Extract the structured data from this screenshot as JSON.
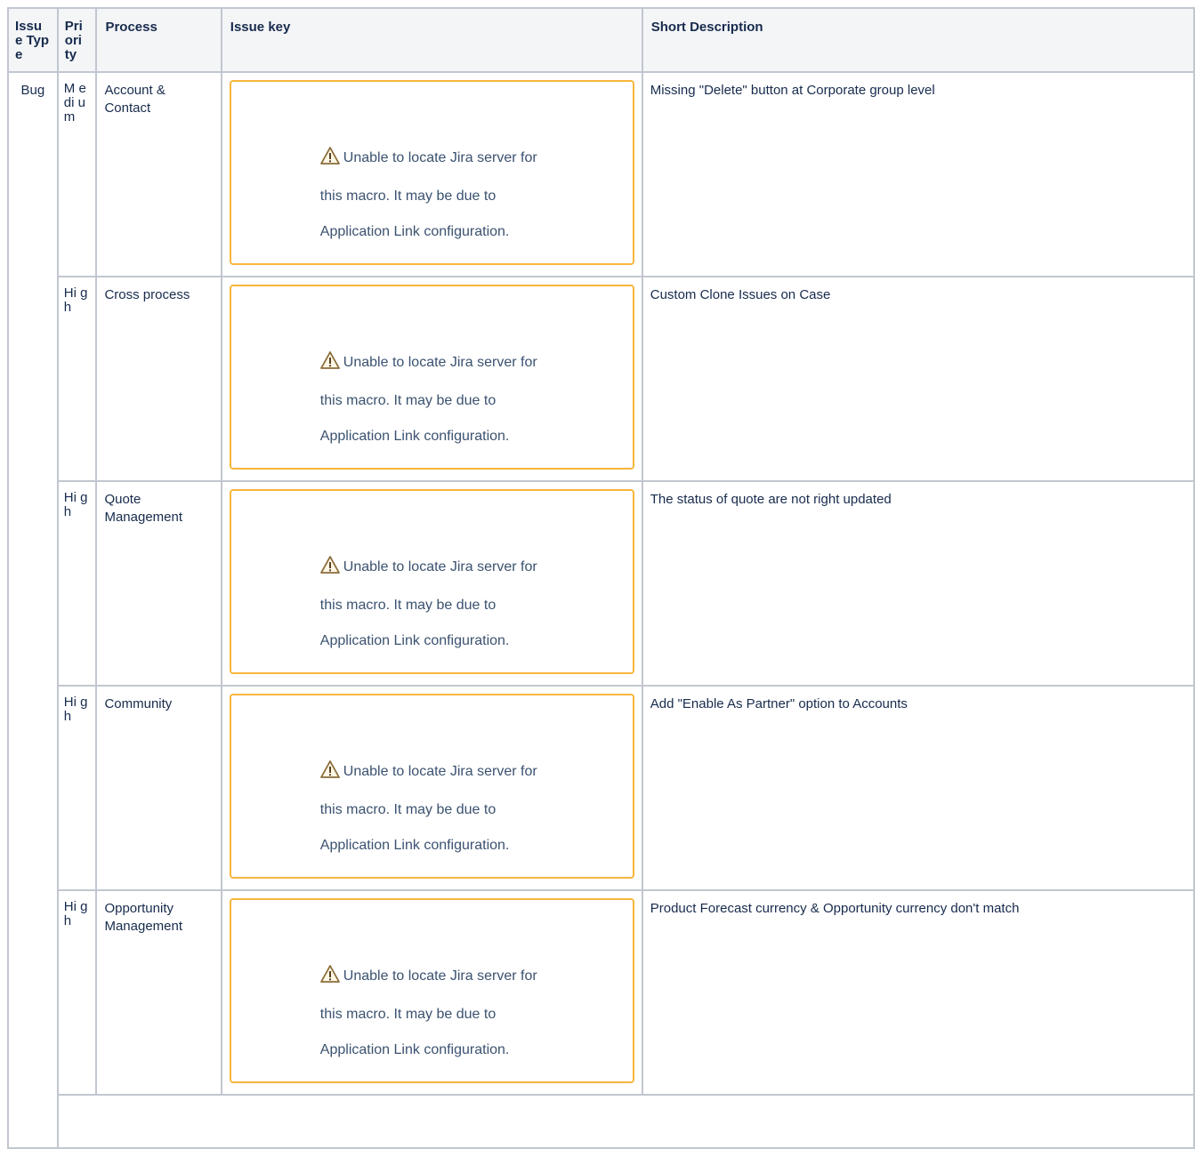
{
  "headers": {
    "issue_type": "Issu e Type",
    "priority": "Pri ori ty",
    "process": "Process",
    "issue_key": "Issue key",
    "short_description": "Short Description"
  },
  "issue_type_value": "Bug",
  "warning_text_line1": "Unable to locate Jira server for",
  "warning_text_line2": "this macro. It may be due to",
  "warning_text_line3": "Application Link configuration.",
  "rows": [
    {
      "priority": "M edi um",
      "process": "Account & Contact",
      "description": "Missing \"Delete\" button at Corporate group level"
    },
    {
      "priority": "Hi gh",
      "process": "Cross process",
      "description": "Custom Clone Issues on Case"
    },
    {
      "priority": "Hi gh",
      "process": "Quote Management",
      "description": "The status of quote are not right updated"
    },
    {
      "priority": "Hi gh",
      "process": "Community",
      "description": "Add \"Enable As Partner\" option to Accounts"
    },
    {
      "priority": "Hi gh",
      "process": "Opportunity Management",
      "description": "Product Forecast currency & Opportunity currency don't match"
    }
  ],
  "icons": {
    "warning": "warning-triangle-icon"
  },
  "colors": {
    "border": "#c1c7d0",
    "warning_border": "#f7b63d",
    "header_bg": "#f4f5f7",
    "text": "#172b4d"
  }
}
